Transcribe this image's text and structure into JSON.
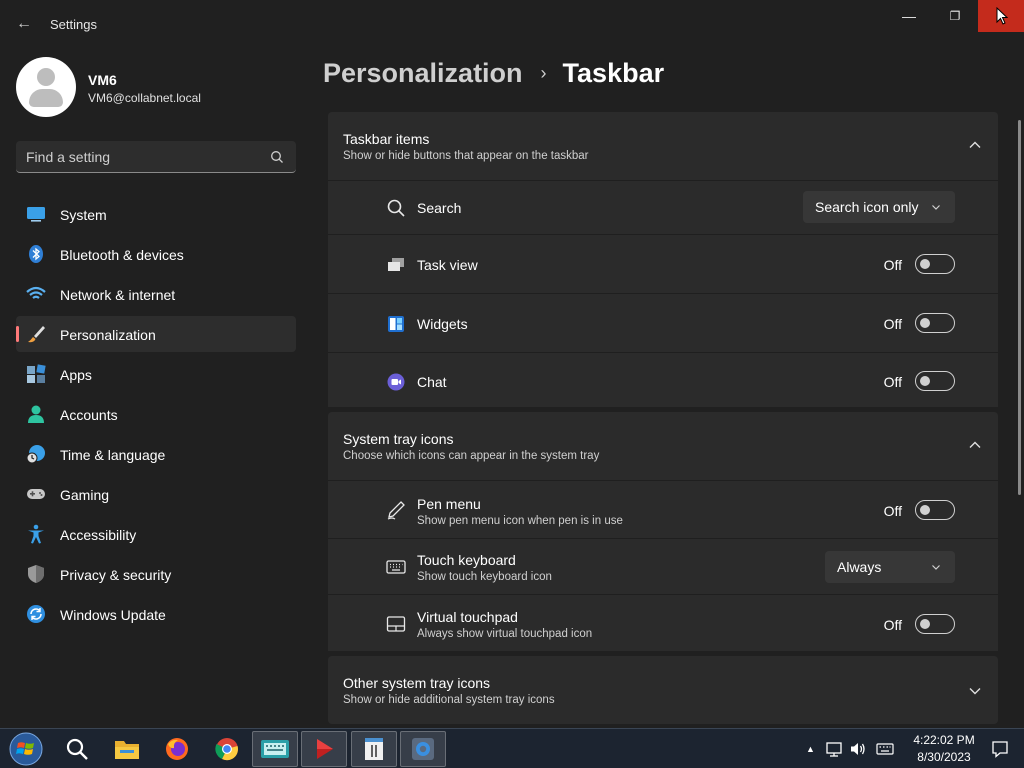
{
  "window": {
    "title": "Settings",
    "back_glyph": "←",
    "min_glyph": "—",
    "max_glyph": "❐",
    "close_glyph": "✕"
  },
  "profile": {
    "name": "VM6",
    "email": "VM6@collabnet.local"
  },
  "search": {
    "placeholder": "Find a setting"
  },
  "sidebar": {
    "items": [
      {
        "label": "System",
        "icon": "monitor-icon"
      },
      {
        "label": "Bluetooth & devices",
        "icon": "bluetooth-icon"
      },
      {
        "label": "Network & internet",
        "icon": "wifi-icon"
      },
      {
        "label": "Personalization",
        "icon": "brush-icon",
        "active": true
      },
      {
        "label": "Apps",
        "icon": "apps-icon"
      },
      {
        "label": "Accounts",
        "icon": "person-icon"
      },
      {
        "label": "Time & language",
        "icon": "globe-clock-icon"
      },
      {
        "label": "Gaming",
        "icon": "gamepad-icon"
      },
      {
        "label": "Accessibility",
        "icon": "accessibility-icon"
      },
      {
        "label": "Privacy & security",
        "icon": "shield-icon"
      },
      {
        "label": "Windows Update",
        "icon": "sync-icon"
      }
    ]
  },
  "breadcrumb": {
    "parent": "Personalization",
    "separator": "›",
    "current": "Taskbar"
  },
  "taskbar_items": {
    "title": "Taskbar items",
    "subtitle": "Show or hide buttons that appear on the taskbar",
    "rows": {
      "search": {
        "label": "Search",
        "value": "Search icon only"
      },
      "task_view": {
        "label": "Task view",
        "state": "Off"
      },
      "widgets": {
        "label": "Widgets",
        "state": "Off"
      },
      "chat": {
        "label": "Chat",
        "state": "Off"
      }
    }
  },
  "system_tray": {
    "title": "System tray icons",
    "subtitle": "Choose which icons can appear in the system tray",
    "rows": {
      "pen_menu": {
        "label": "Pen menu",
        "sub": "Show pen menu icon when pen is in use",
        "state": "Off"
      },
      "touch_keyboard": {
        "label": "Touch keyboard",
        "sub": "Show touch keyboard icon",
        "value": "Always"
      },
      "virtual_touchpad": {
        "label": "Virtual touchpad",
        "sub": "Always show virtual touchpad icon",
        "state": "Off"
      }
    }
  },
  "other_tray": {
    "title": "Other system tray icons",
    "subtitle": "Show or hide additional system tray icons"
  },
  "os_taskbar": {
    "apps": [
      "start-orb-icon",
      "search-icon",
      "file-explorer-icon",
      "firefox-icon",
      "chrome-icon",
      "keyboard-app-icon",
      "media-player-icon",
      "notepad-icon",
      "settings-gear-icon"
    ],
    "time": "4:22:02 PM",
    "date": "8/30/2023",
    "tray_up_glyph": "▲"
  },
  "colors": {
    "background": "#202020",
    "card": "#2b2b2b",
    "accent_indicator": "#ff7a7a",
    "close_button": "#c42b1c"
  }
}
